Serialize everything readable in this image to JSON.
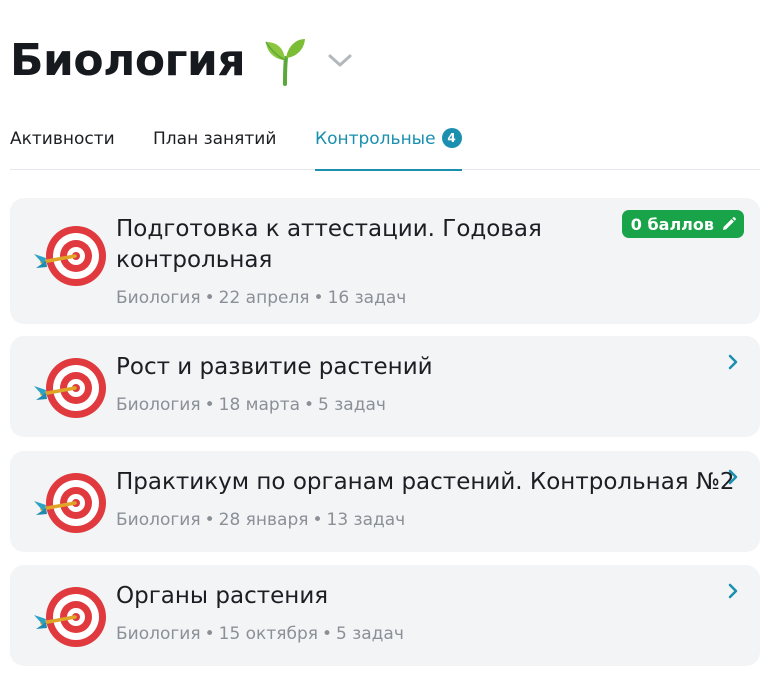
{
  "header": {
    "title": "Биология",
    "title_icon": "sprout-icon",
    "dropdown_icon": "chevron-down-icon"
  },
  "tabs": [
    {
      "label": "Активности",
      "active": false
    },
    {
      "label": "План занятий",
      "active": false
    },
    {
      "label": "Контрольные",
      "active": true,
      "badge": "4"
    }
  ],
  "colors": {
    "accent": "#1a8fb0",
    "badge_green": "#1aa44a",
    "card_bg": "#f2f4f6",
    "meta_text": "#8b9097"
  },
  "tests": [
    {
      "title": "Подготовка к аттестации. Годовая контрольная",
      "subject": "Биология",
      "date": "22 апреля",
      "tasks": "16 задач",
      "score_label": "0 баллов",
      "icon": "target-icon",
      "action_icon": "pencil-icon"
    },
    {
      "title": "Рост и развитие растений",
      "subject": "Биология",
      "date": "18 марта",
      "tasks": "5 задач",
      "icon": "target-icon",
      "action_icon": "chevron-right-icon"
    },
    {
      "title": "Практикум по органам растений. Контрольная №2",
      "subject": "Биология",
      "date": "28 января",
      "tasks": "13 задач",
      "icon": "target-icon",
      "action_icon": "chevron-right-icon"
    },
    {
      "title": "Органы растения",
      "subject": "Биология",
      "date": "15 октября",
      "tasks": "5 задач",
      "icon": "target-icon",
      "action_icon": "chevron-right-icon"
    }
  ]
}
